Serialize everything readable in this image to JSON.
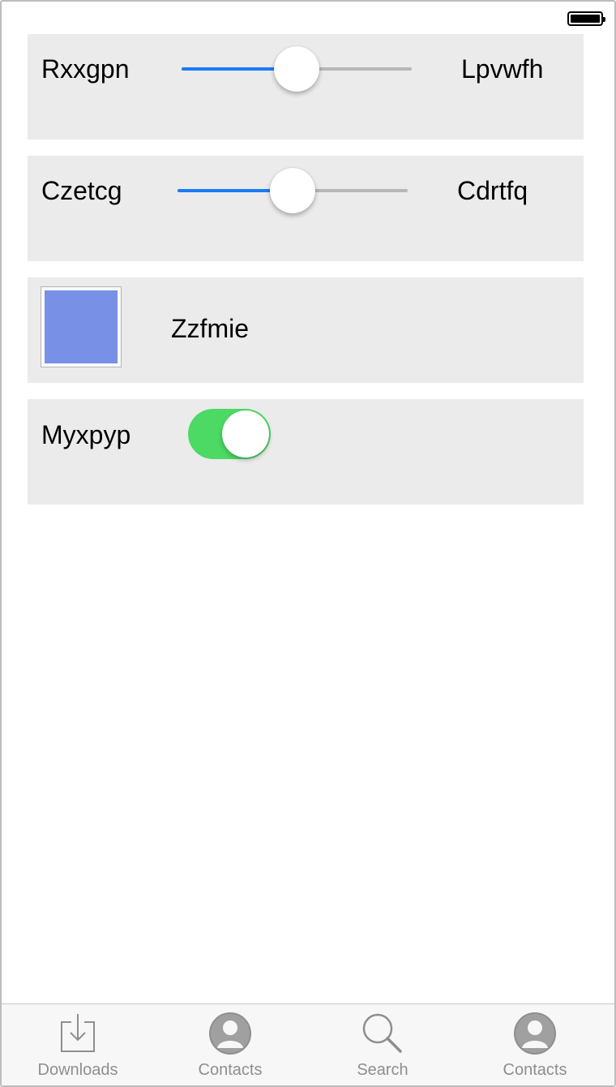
{
  "colors": {
    "row_background": "#ebebeb",
    "slider_fill": "#1a7cf4",
    "slider_track": "#b7b7b7",
    "swatch": "#7890e6",
    "toggle_on": "#4cd964",
    "tab_inactive": "#8e8e8e"
  },
  "rows": {
    "slider1": {
      "left_label": "Rxxgpn",
      "right_label": "Lpvwfh",
      "value": 0.5
    },
    "slider2": {
      "left_label": "Czetcg",
      "right_label": "Cdrtfq",
      "value": 0.5
    },
    "color": {
      "label": "Zzfmie"
    },
    "toggle": {
      "label": "Myxpyp",
      "on": true
    }
  },
  "tabs": [
    {
      "label": "Downloads",
      "icon": "downloads-icon"
    },
    {
      "label": "Contacts",
      "icon": "contacts-icon"
    },
    {
      "label": "Search",
      "icon": "search-icon"
    },
    {
      "label": "Contacts",
      "icon": "contacts-icon"
    }
  ]
}
